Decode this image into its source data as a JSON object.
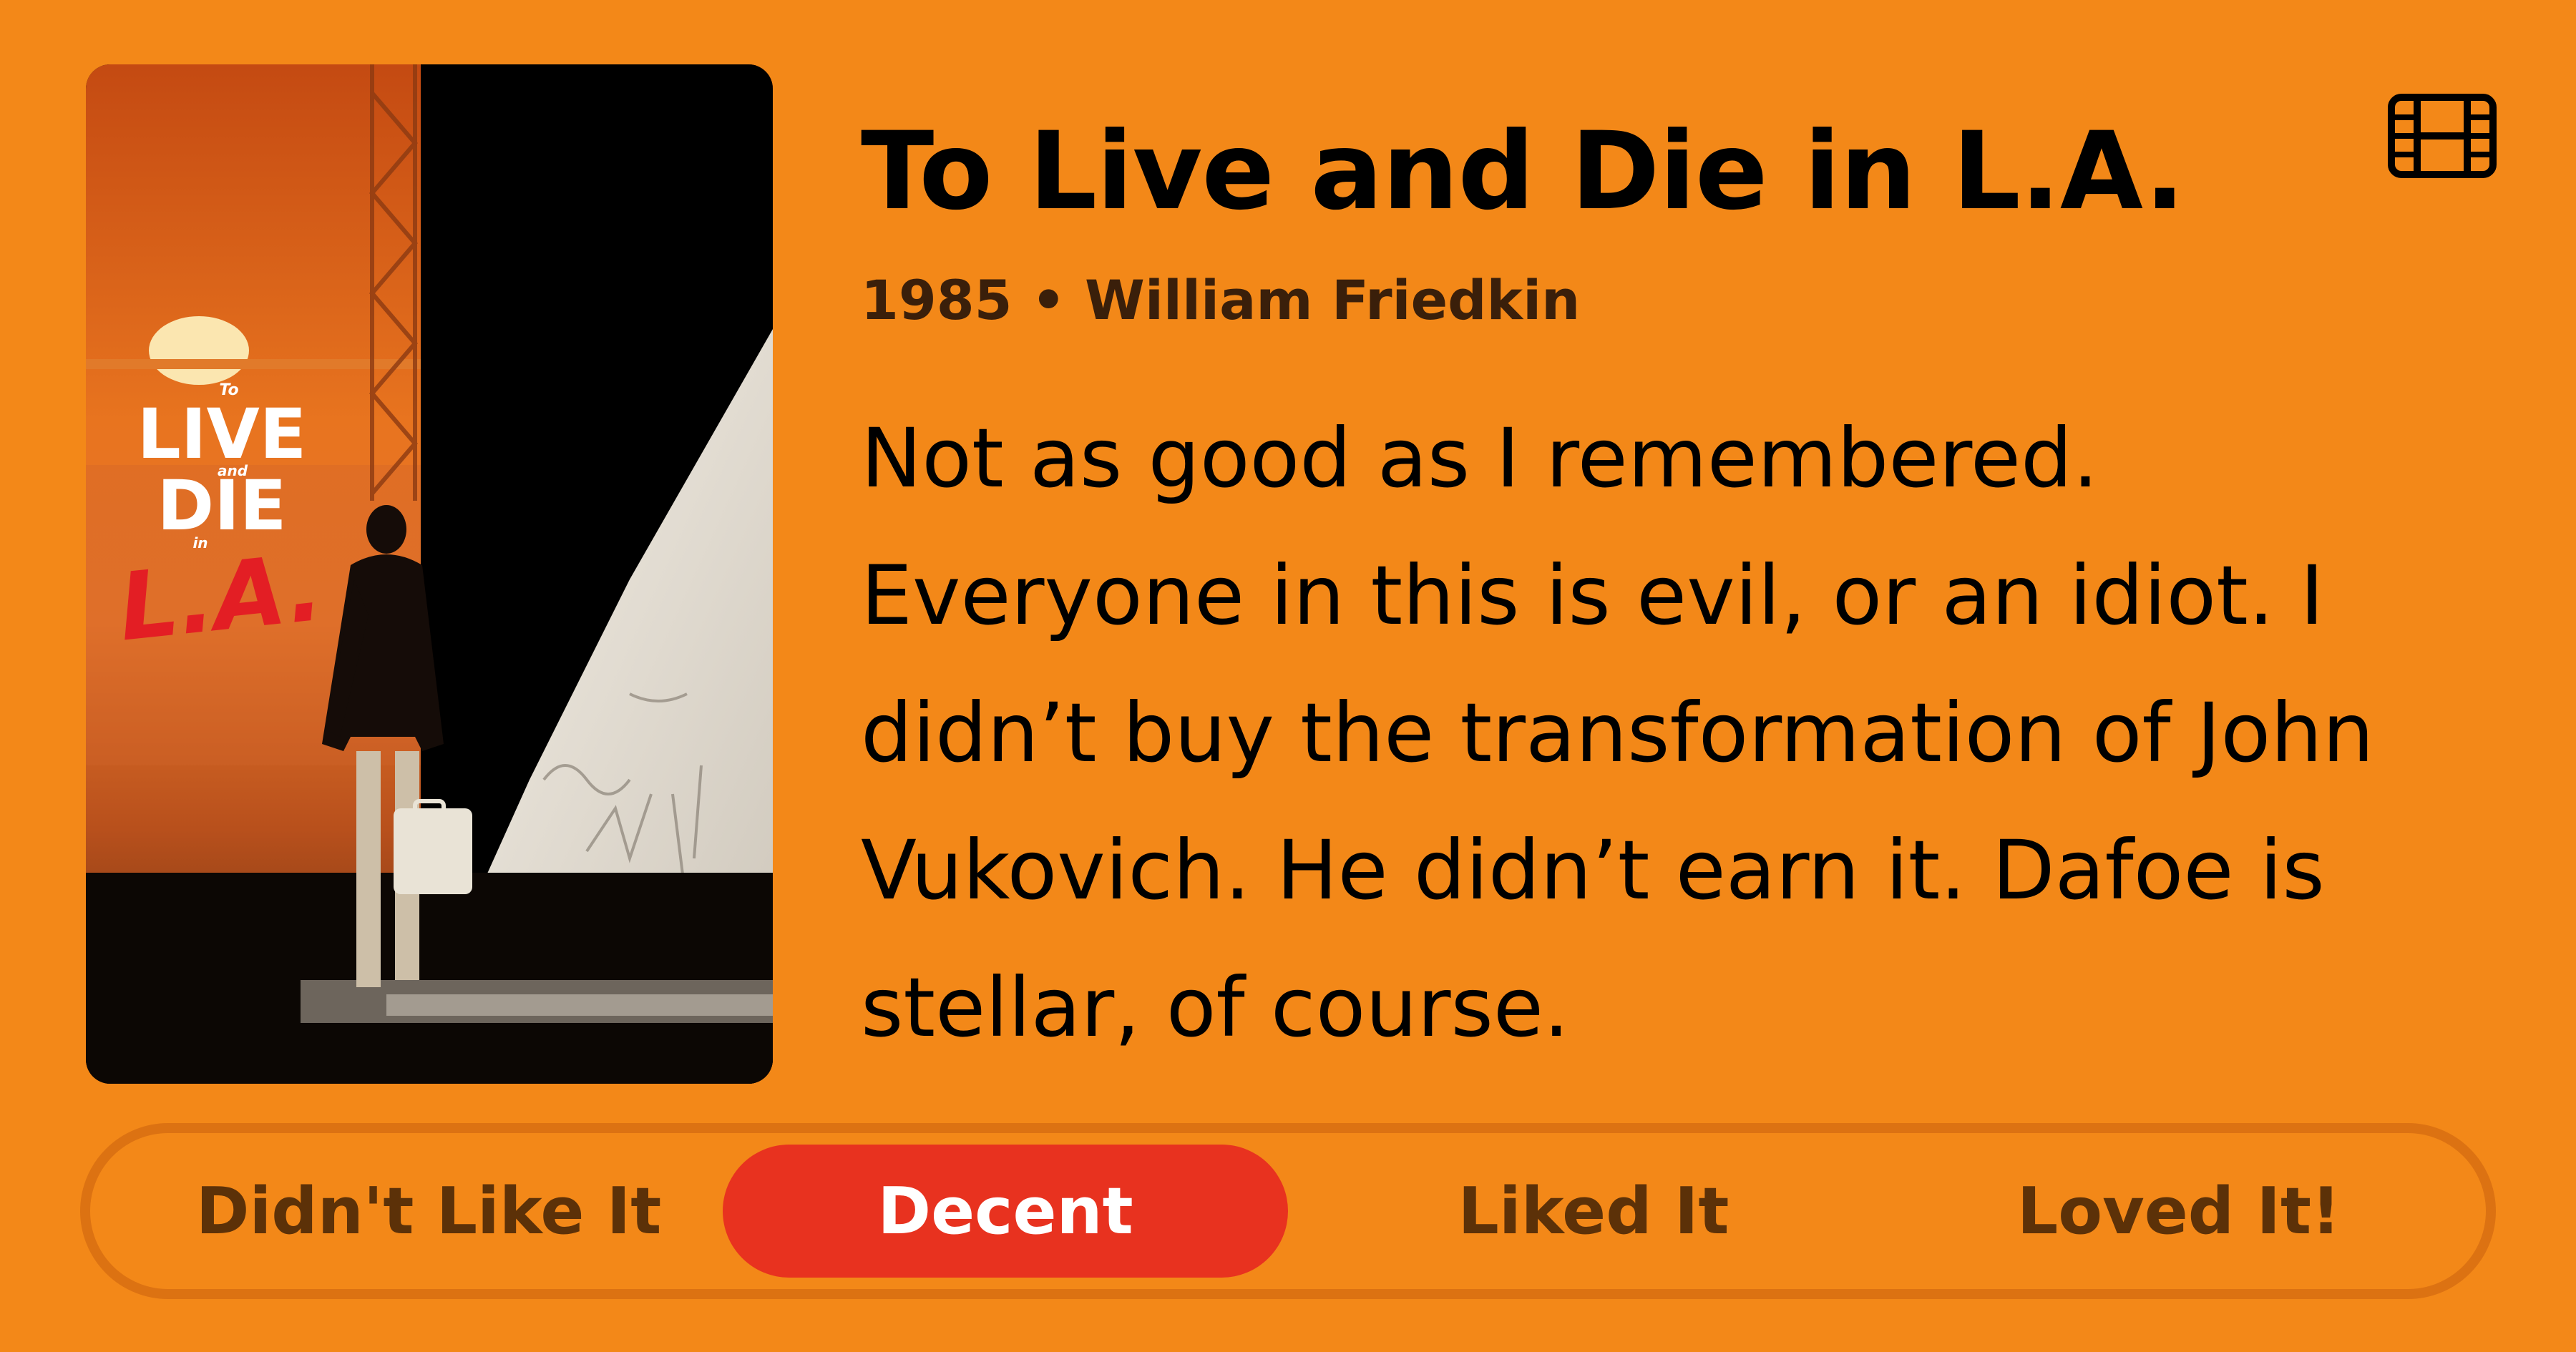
{
  "movie": {
    "title": "To Live and Die in L.A.",
    "year": "1985",
    "separator": "•",
    "director": "William Friedkin",
    "review": "Not as good as I remembered. Everyone in this is evil, or an idiot. I didn’t buy the transformation of John Vukovich. He didn’t earn it. Dafoe is stellar, of course."
  },
  "poster": {
    "logo_line1": "To",
    "logo_line2": "LIVE",
    "logo_line3": "and",
    "logo_line4": "DIE",
    "logo_line5": "in",
    "logo_line6": "L.A."
  },
  "icons": {
    "type_icon": "film-icon"
  },
  "rating": {
    "options": [
      "Didn't Like It",
      "Decent",
      "Liked It",
      "Loved It!"
    ],
    "selected": "Decent"
  },
  "colors": {
    "background": "#f38818",
    "selected_option": "#e8321f",
    "option_text": "#5c3108",
    "meta_text": "#3a1f0a"
  }
}
